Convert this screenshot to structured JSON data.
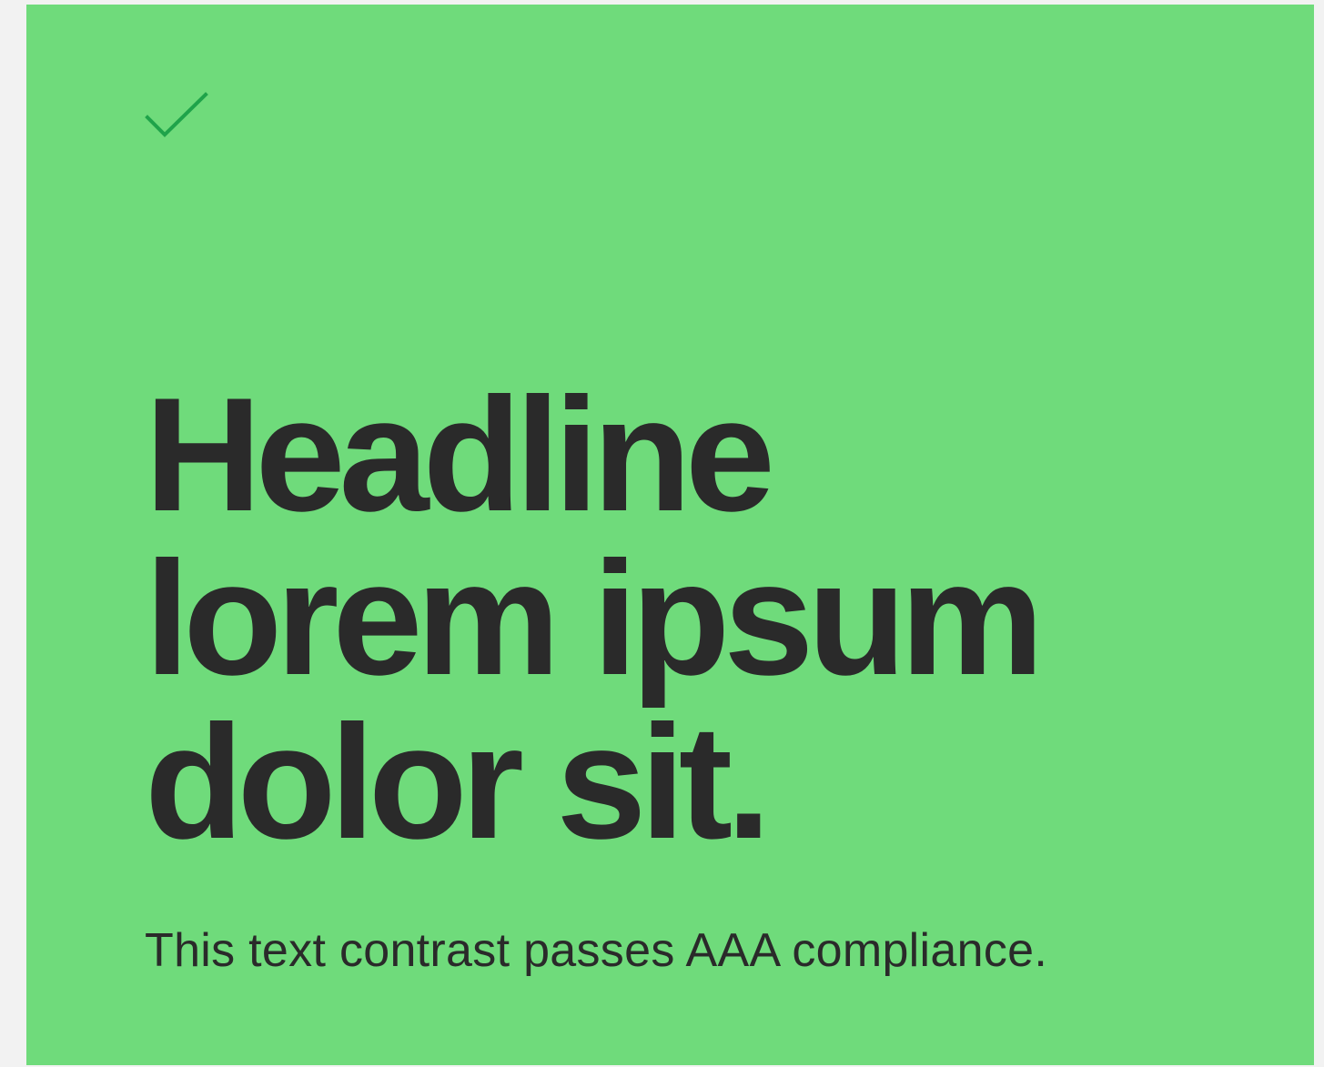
{
  "card": {
    "background_color": "#6fdb7b",
    "text_color": "#2a2a2a",
    "icon": "check-icon",
    "icon_color": "#1fa34a",
    "headline_lines": [
      "Headline",
      "lorem ipsum",
      "dolor sit."
    ],
    "caption": "This text contrast passes AAA compliance."
  }
}
